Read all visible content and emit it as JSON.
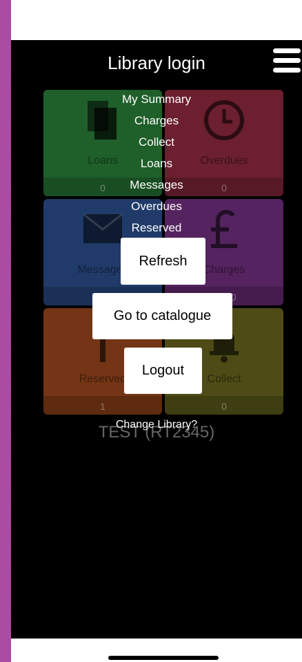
{
  "header": {
    "title": "Library login",
    "menu_icon": "hamburger-menu-icon"
  },
  "tiles": [
    {
      "label": "Loans",
      "count": "0",
      "color": "#1f5f2a",
      "icon": "documents-icon"
    },
    {
      "label": "Overdues",
      "count": "0",
      "color": "#6b1f2f",
      "icon": "clock-icon"
    },
    {
      "label": "Messages",
      "count": "0",
      "color": "#203b69",
      "icon": "envelope-icon"
    },
    {
      "label": "Charges",
      "count": "£0.00",
      "color": "#55235f",
      "icon": "pound-icon"
    },
    {
      "label": "Reserved",
      "count": "1",
      "color": "#733515",
      "icon": "bookmark-icon"
    },
    {
      "label": "Collect",
      "count": "0",
      "color": "#4e4b16",
      "icon": "bell-icon"
    }
  ],
  "library_name": "TEST (RT2345)",
  "menu": {
    "items": [
      "My Summary",
      "Charges",
      "Collect",
      "Loans",
      "Messages",
      "Overdues",
      "Reserved"
    ],
    "refresh": "Refresh",
    "catalogue": "Go to catalogue",
    "logout": "Logout",
    "change_library": "Change Library?"
  }
}
